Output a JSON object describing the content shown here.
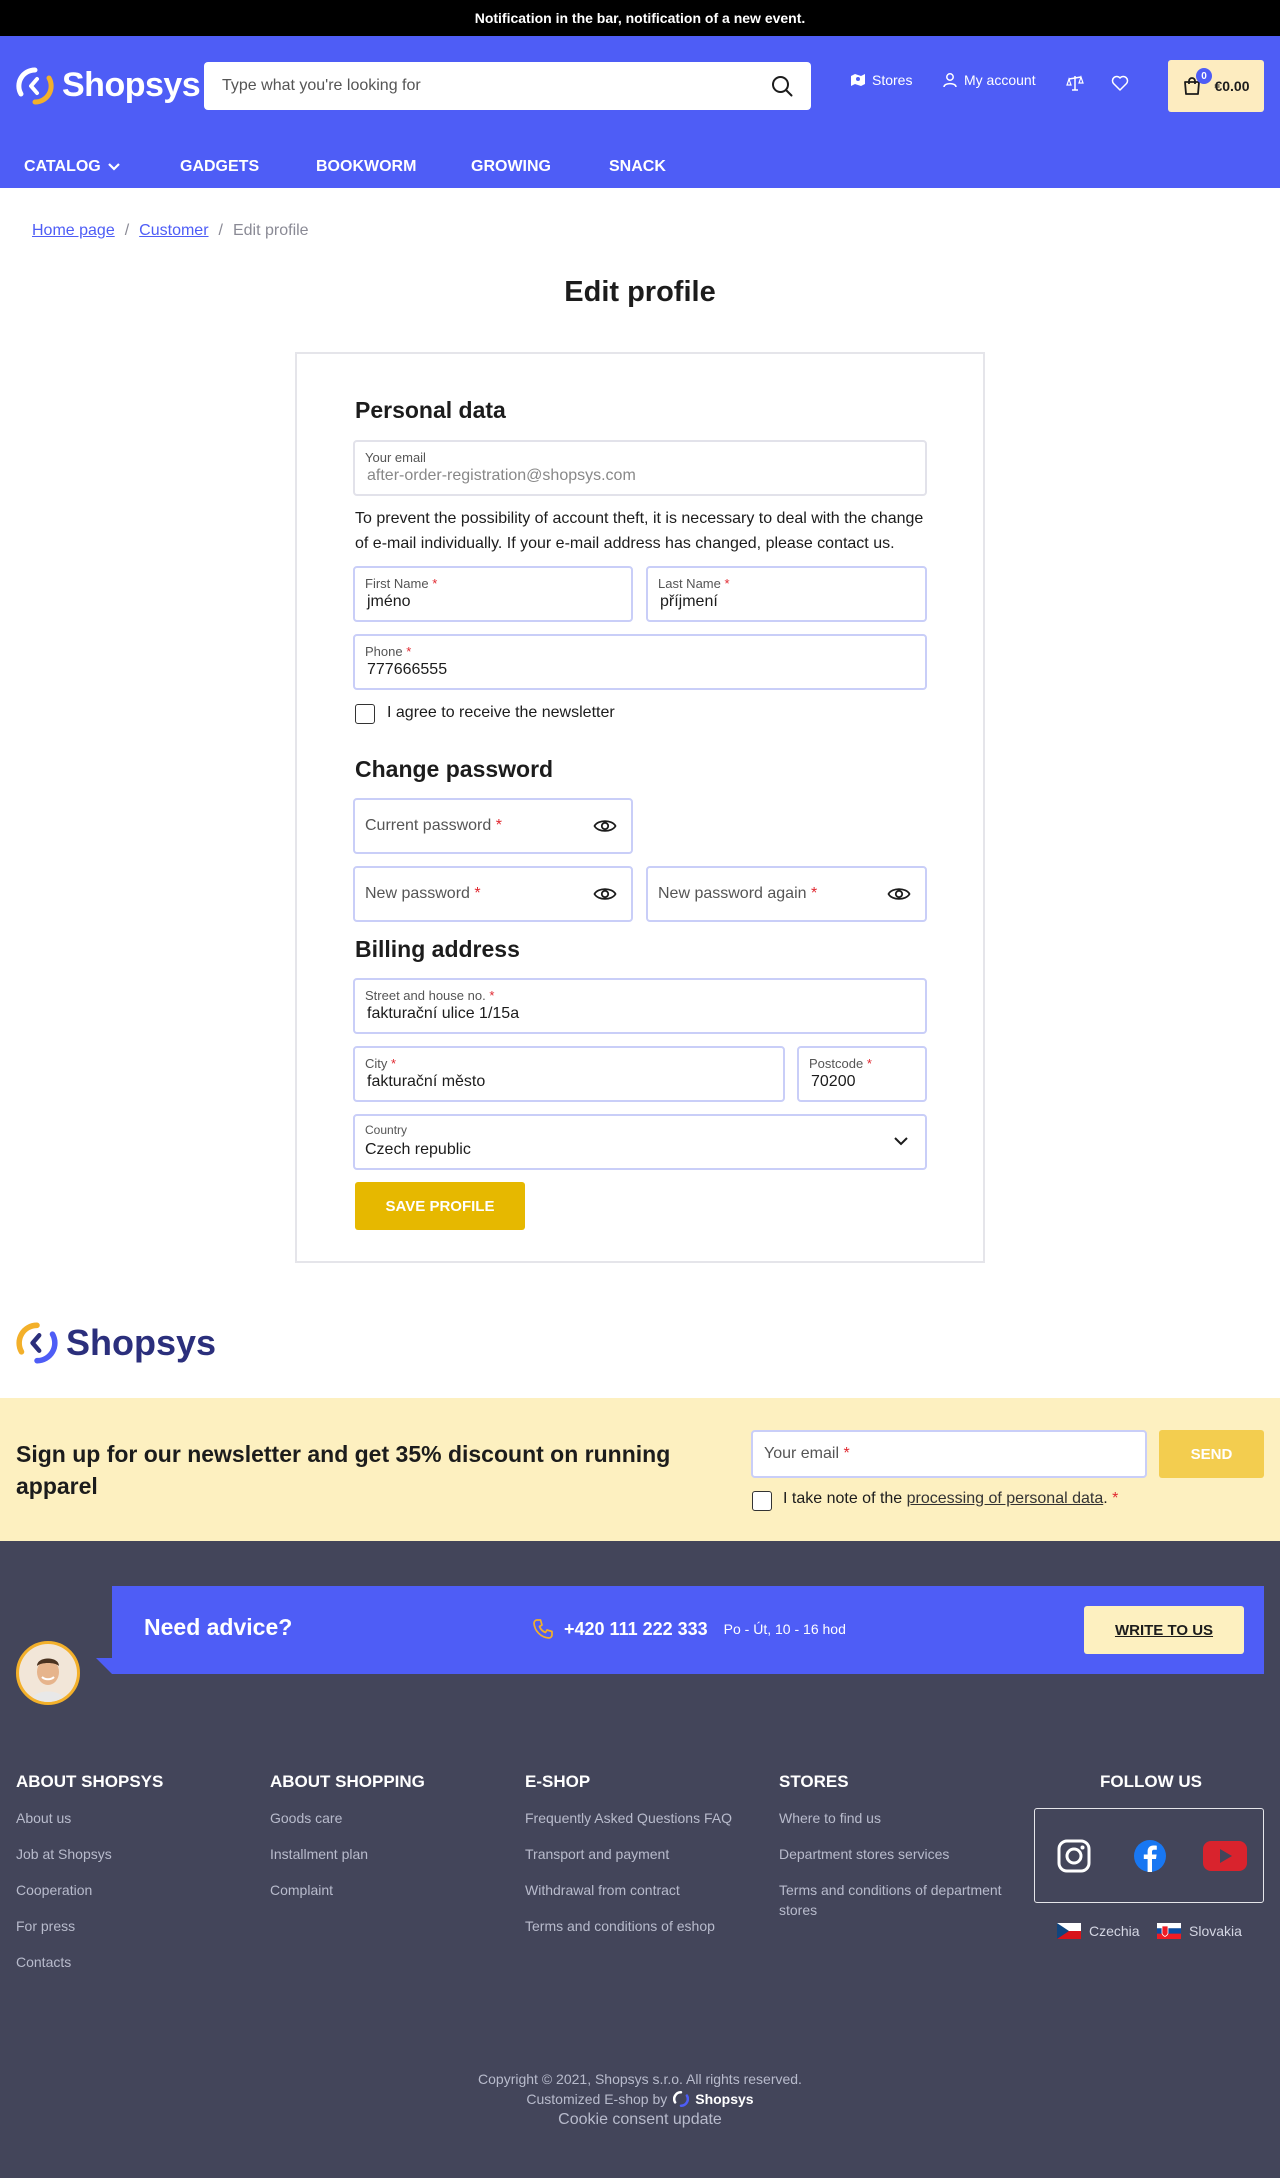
{
  "notification": {
    "text": "Notification in the bar, notification of a new event."
  },
  "header": {
    "logo_text": "Shopsys",
    "search_placeholder": "Type what you're looking for",
    "stores_label": "Stores",
    "account_label": "My account",
    "cart_count": "0",
    "cart_total": "€0.00"
  },
  "nav": {
    "items": [
      {
        "label": "CATALOG"
      },
      {
        "label": "GADGETS"
      },
      {
        "label": "BOOKWORM"
      },
      {
        "label": "GROWING"
      },
      {
        "label": "SNACK"
      }
    ]
  },
  "breadcrumb": {
    "home": "Home page",
    "customer": "Customer",
    "separator": "/",
    "current": "Edit profile"
  },
  "page": {
    "title": "Edit profile"
  },
  "form": {
    "personal_title": "Personal data",
    "email_label": "Your email",
    "email_value": "after-order-registration@shopsys.com",
    "note": "To prevent the possibility of account theft, it is necessary to deal with the change of e-mail individually. If your e-mail address has changed, please contact us.",
    "first_name_label": "First Name",
    "first_name_value": "jméno",
    "last_name_label": "Last Name",
    "last_name_value": "příjmení",
    "phone_label": "Phone",
    "phone_value": "777666555",
    "newsletter_label": "I agree to receive the newsletter",
    "password_title": "Change password",
    "current_password_label": "Current password",
    "new_password_label": "New password",
    "new_password_again_label": "New password again",
    "billing_title": "Billing address",
    "street_label": "Street and house no.",
    "street_value": "fakturační ulice 1/15a",
    "city_label": "City",
    "city_value": "fakturační město",
    "postcode_label": "Postcode",
    "postcode_value": "70200",
    "country_label": "Country",
    "country_value": "Czech republic",
    "required_mark": "*",
    "save_label": "SAVE PROFILE"
  },
  "footer_logo": {
    "text": "Shopsys"
  },
  "newsletter": {
    "title": "Sign up for our newsletter and get 35% discount on running apparel",
    "email_placeholder": "Your email",
    "send_label": "SEND",
    "consent_prefix": "I take note of the",
    "consent_link": "processing of personal data",
    "consent_suffix": "."
  },
  "advice": {
    "title": "Need advice?",
    "phone": "+420 111 222 333",
    "hours": "Po - Út, 10 - 16 hod",
    "button_label": "WRITE TO US"
  },
  "footer": {
    "columns": [
      {
        "title": "ABOUT SHOPSYS",
        "links": [
          "About us",
          "Job at Shopsys",
          "Cooperation",
          "For press",
          "Contacts"
        ]
      },
      {
        "title": "ABOUT SHOPPING",
        "links": [
          "Goods care",
          "Installment plan",
          "Complaint"
        ]
      },
      {
        "title": "E-SHOP",
        "links": [
          "Frequently Asked Questions FAQ",
          "Transport and payment",
          "Withdrawal from contract",
          "Terms and conditions of eshop"
        ]
      },
      {
        "title": "STORES",
        "links": [
          "Where to find us",
          "Department stores services",
          "Terms and conditions of department stores"
        ]
      }
    ],
    "follow_title": "FOLLOW US",
    "languages": [
      "Czechia",
      "Slovakia"
    ],
    "copyright": "Copyright © 2021, Shopsys s.r.o. All rights reserved.",
    "customized_by": "Customized E-shop by",
    "customized_logo": "Shopsys",
    "cookie_label": "Cookie consent update"
  },
  "colors": {
    "brand_blue": "#4e5df6",
    "accent_yellow": "#e6b800",
    "newsletter_bg": "#fdf0c0",
    "footer_bg": "#43455a"
  },
  "icons": [
    "search-icon",
    "stores-icon",
    "user-icon",
    "compare-icon",
    "heart-icon",
    "cart-icon",
    "chevron-down-icon",
    "eye-icon",
    "phone-icon",
    "instagram-icon",
    "facebook-icon",
    "youtube-icon"
  ]
}
